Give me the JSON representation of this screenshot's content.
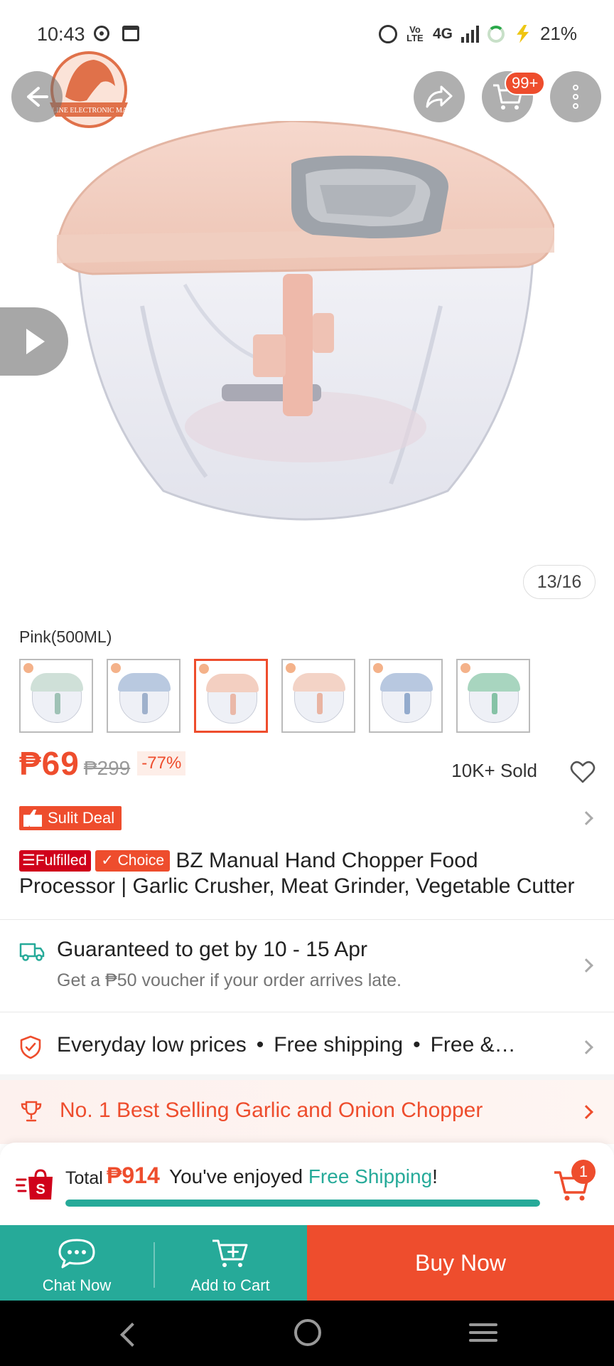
{
  "status_bar": {
    "time": "10:43",
    "volte": "Vo LTE",
    "network": "4G",
    "battery": "21%"
  },
  "header": {
    "cart_badge": "99+"
  },
  "gallery": {
    "counter": "13/16"
  },
  "variation": {
    "selected_label": "Pink(500ML)",
    "thumbnails": [
      {
        "lid": "#cfe0d8",
        "stem": "#9fc2b6"
      },
      {
        "lid": "#b9c9e0",
        "stem": "#9fb1cc"
      },
      {
        "lid": "#f3cfc1",
        "stem": "#eab8a8"
      },
      {
        "lid": "#f3d3c6",
        "stem": "#e9b4a2"
      },
      {
        "lid": "#b8c8e0",
        "stem": "#93abcd"
      },
      {
        "lid": "#a8d5bf",
        "stem": "#86c2a6"
      }
    ]
  },
  "price": {
    "current": "₱69",
    "original": "₱299",
    "discount": "-77%",
    "sold": "10K+ Sold"
  },
  "deal": {
    "label": "Sulit Deal"
  },
  "title": {
    "fulfilled_tag": "Fulfilled",
    "choice_tag": "Choice",
    "line1": "BZ Manual Hand Chopper Food",
    "line2": "Processor | Garlic Crusher, Meat Grinder, Vegetable Cutter"
  },
  "delivery": {
    "title": "Guaranteed to get by 10 - 15 Apr",
    "subtitle": "Get a ₱50 voucher if your order arrives late."
  },
  "benefits": {
    "items": [
      "Everyday low prices",
      "Free shipping",
      "Free &…"
    ]
  },
  "best_seller": {
    "text": "No. 1 Best Selling Garlic and Onion Chopper"
  },
  "shipping_bar": {
    "total_label": "Total",
    "total_amount": "₱914",
    "message_prefix": "You've enjoyed ",
    "message_highlight": "Free Shipping",
    "message_suffix": "!",
    "progress_percent": 100,
    "cart_count": "1"
  },
  "actions": {
    "chat": "Chat Now",
    "add_to_cart": "Add to Cart",
    "buy_now": "Buy Now"
  },
  "colors": {
    "accent": "#ee4d2d",
    "teal": "#26aa99",
    "fulfilled_red": "#d0011b"
  }
}
